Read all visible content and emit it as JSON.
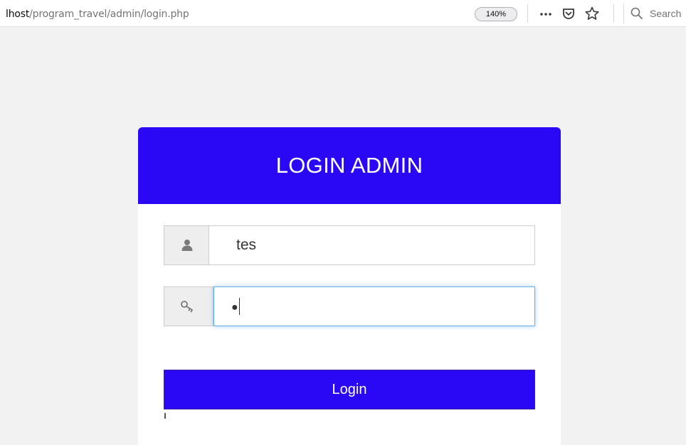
{
  "browser": {
    "url_host": "lhost",
    "url_path": "/program_travel/admin/login.php",
    "zoom": "140%",
    "search_placeholder": "Search",
    "icons": [
      "more-icon",
      "pocket-icon",
      "bookmark-star-icon",
      "search-icon"
    ]
  },
  "login": {
    "title": "LOGIN ADMIN",
    "username_value": "tes",
    "password_mask": "●",
    "button_label": "Login"
  },
  "colors": {
    "accent": "#2b08f5",
    "page_bg": "#f2f2f2",
    "focus_border": "#66afe9"
  }
}
